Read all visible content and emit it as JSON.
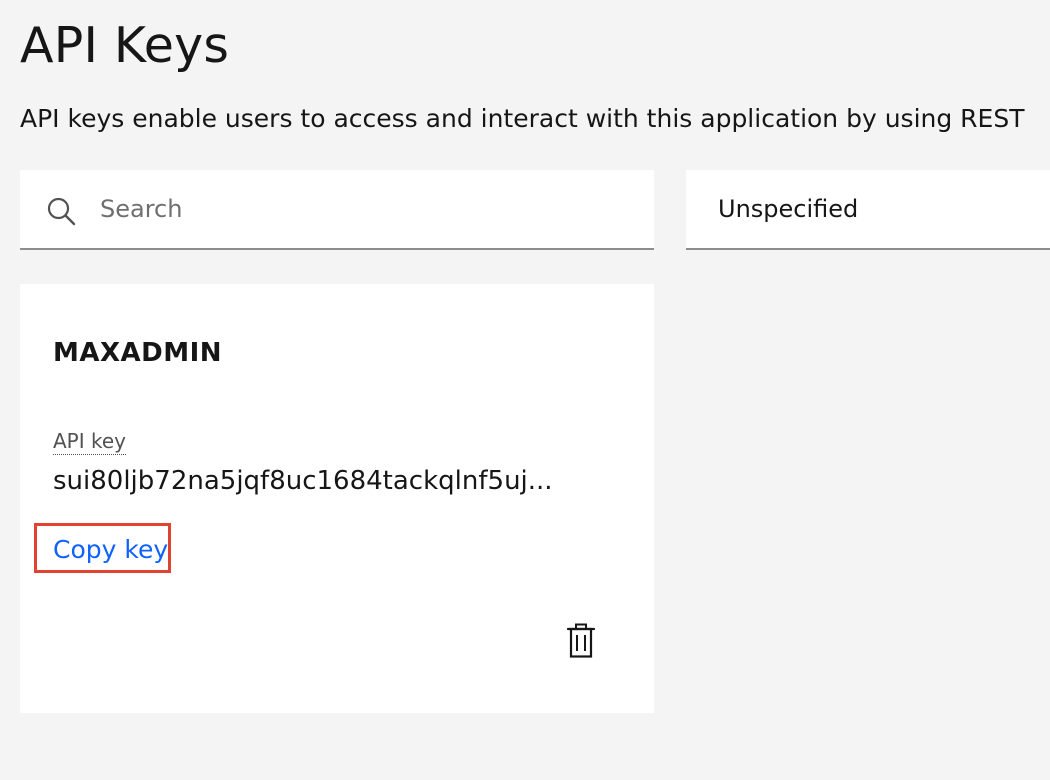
{
  "page": {
    "title": "API Keys",
    "description": "API keys enable users to access and interact with this application by using REST"
  },
  "search": {
    "placeholder": "Search",
    "value": "",
    "icon": "search-icon"
  },
  "filter": {
    "selected": "Unspecified"
  },
  "cards": [
    {
      "user": "MAXADMIN",
      "key_label": "API key",
      "key_value": "sui80ljb72na5jqf8uc1684tackqlnf5uj...",
      "copy_label": "Copy key",
      "delete_icon": "trash-icon"
    }
  ],
  "colors": {
    "background": "#f4f4f4",
    "surface": "#ffffff",
    "link": "#0f62fe",
    "highlight": "#e0432f",
    "text": "#161616"
  }
}
